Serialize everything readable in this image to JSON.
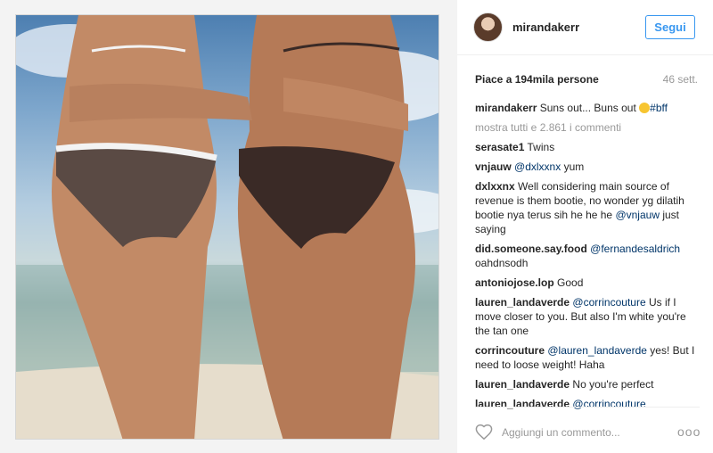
{
  "post": {
    "username": "mirandakerr",
    "follow_label": "Segui",
    "likes_text": "Piace a 194mila persone",
    "time_ago": "46 sett.",
    "caption": {
      "user": "mirandakerr",
      "text": "Suns out... Buns out",
      "hashtag": "#bff"
    },
    "load_more_label": "mostra tutti e 2.861 i commenti",
    "comments": [
      {
        "user": "serasate1",
        "mention": "",
        "text": "Twins"
      },
      {
        "user": "vnjauw",
        "mention": "@dxlxxnx",
        "text": "yum"
      },
      {
        "user": "dxlxxnx",
        "mention": "",
        "text": "Well considering main source of revenue is them bootie, no wonder yg dilatih bootie nya terus sih he he he",
        "mention2": "@vnjauw",
        "text2": "just saying"
      },
      {
        "user": "did.someone.say.food",
        "mention": "@fernandesaldrich",
        "text": "oahdnsodh"
      },
      {
        "user": "antoniojose.lop",
        "mention": "",
        "text": "Good"
      },
      {
        "user": "lauren_landaverde",
        "mention": "@corrincouture",
        "text": "Us if I move closer to you. But also I'm white you're the tan one"
      },
      {
        "user": "corrincouture",
        "mention": "@lauren_landaverde",
        "text": "yes! But I need to loose weight! Haha"
      },
      {
        "user": "lauren_landaverde",
        "mention": "",
        "text": "No you're perfect"
      },
      {
        "user": "lauren_landaverde",
        "mention": "@corrincouture",
        "text": ""
      }
    ],
    "comment_placeholder": "Aggiungi un commento...",
    "more_options": "ooo",
    "icons": {
      "heart": "heart-icon",
      "more": "more-options-icon",
      "emoji": "smirk-emoji-icon"
    }
  }
}
